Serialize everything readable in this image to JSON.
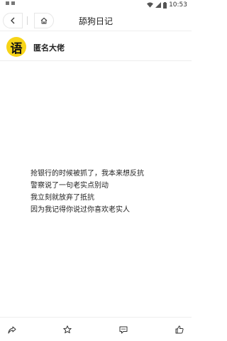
{
  "status_bar": {
    "time": "10:53"
  },
  "nav": {
    "title": "舔狗日记"
  },
  "author": {
    "avatar_char": "语",
    "name": "匿名大佬"
  },
  "story": {
    "lines": [
      "抢银行的时候被抓了，我本来想反抗",
      "警察说了一句老实点别动",
      "我立刻就放弃了抵抗",
      "因为我记得你说过你喜欢老实人"
    ]
  },
  "icons": {
    "back": "chevron-left-icon",
    "home": "home-icon",
    "share": "share-icon",
    "favorite": "star-icon",
    "comment": "comment-icon",
    "like": "thumbs-up-icon"
  },
  "colors": {
    "avatar_bg": "#f7d417",
    "text": "#222222",
    "divider": "#eeeeee"
  }
}
